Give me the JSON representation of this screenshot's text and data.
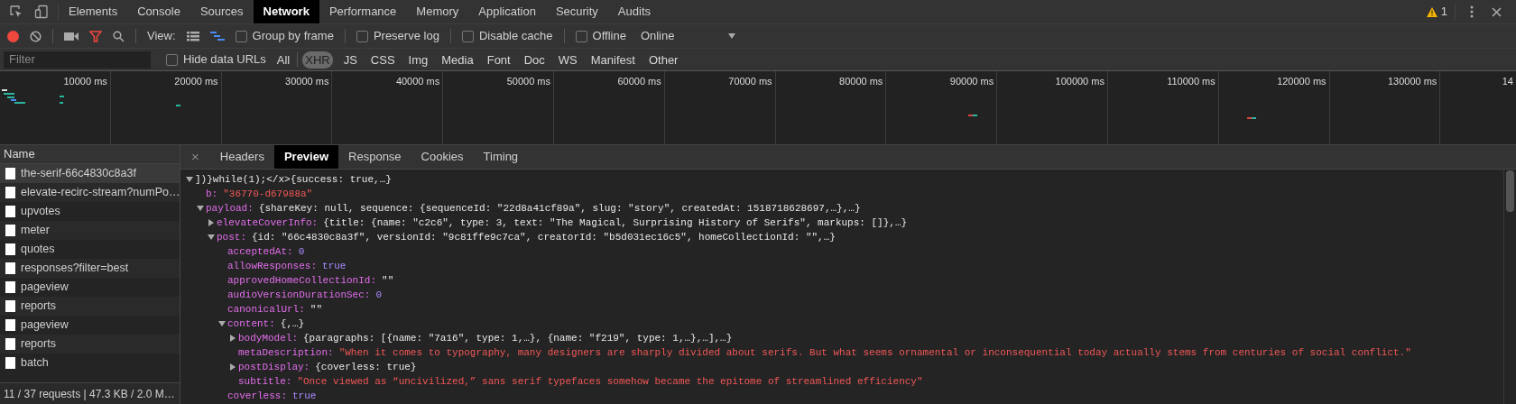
{
  "main_tabs": [
    {
      "label": "Elements",
      "selected": false
    },
    {
      "label": "Console",
      "selected": false
    },
    {
      "label": "Sources",
      "selected": false
    },
    {
      "label": "Network",
      "selected": true
    },
    {
      "label": "Performance",
      "selected": false
    },
    {
      "label": "Memory",
      "selected": false
    },
    {
      "label": "Application",
      "selected": false
    },
    {
      "label": "Security",
      "selected": false
    },
    {
      "label": "Audits",
      "selected": false
    }
  ],
  "warnings": "1",
  "toolbar": {
    "recording": true,
    "filter_active": true,
    "view_label": "View:",
    "large_rows": false,
    "waterfall": true,
    "options": [
      {
        "label": "Group by frame",
        "checked": false
      },
      {
        "label": "Preserve log",
        "checked": false
      },
      {
        "label": "Disable cache",
        "checked": false
      },
      {
        "label": "Offline",
        "checked": false
      }
    ],
    "throttling": "Online"
  },
  "filter_bar": {
    "placeholder": "Filter",
    "hide_data_urls": {
      "label": "Hide data URLs",
      "checked": false
    },
    "types": [
      {
        "label": "All",
        "selected": false
      },
      {
        "label": "XHR",
        "selected": true
      },
      {
        "label": "JS",
        "selected": false
      },
      {
        "label": "CSS",
        "selected": false
      },
      {
        "label": "Img",
        "selected": false
      },
      {
        "label": "Media",
        "selected": false
      },
      {
        "label": "Font",
        "selected": false
      },
      {
        "label": "Doc",
        "selected": false
      },
      {
        "label": "WS",
        "selected": false
      },
      {
        "label": "Manifest",
        "selected": false
      },
      {
        "label": "Other",
        "selected": false
      }
    ]
  },
  "overview": {
    "ticks": [
      "10000 ms",
      "20000 ms",
      "30000 ms",
      "40000 ms",
      "50000 ms",
      "60000 ms",
      "70000 ms",
      "80000 ms",
      "90000 ms",
      "100000 ms",
      "110000 ms",
      "120000 ms",
      "130000 ms",
      "14"
    ]
  },
  "requests": {
    "column": "Name",
    "items": [
      {
        "name": "the-serif-66c4830c8a3f",
        "selected": true
      },
      {
        "name": "elevate-recirc-stream?numPo…",
        "selected": false
      },
      {
        "name": "upvotes",
        "selected": false
      },
      {
        "name": "meter",
        "selected": false
      },
      {
        "name": "quotes",
        "selected": false
      },
      {
        "name": "responses?filter=best",
        "selected": false
      },
      {
        "name": "pageview",
        "selected": false
      },
      {
        "name": "reports",
        "selected": false
      },
      {
        "name": "pageview",
        "selected": false
      },
      {
        "name": "reports",
        "selected": false
      },
      {
        "name": "batch",
        "selected": false
      }
    ],
    "summary": "11 / 37 requests | 47.3 KB / 2.0 M…"
  },
  "detail_tabs": {
    "close": "×",
    "tabs": [
      {
        "label": "Headers",
        "selected": false
      },
      {
        "label": "Preview",
        "selected": true
      },
      {
        "label": "Response",
        "selected": false
      },
      {
        "label": "Cookies",
        "selected": false
      },
      {
        "label": "Timing",
        "selected": false
      }
    ]
  },
  "preview": {
    "label": "])}while(1);</x>",
    "value": "{success: true,…}",
    "kind": "object",
    "expanded": true,
    "children": [
      {
        "key": "b:",
        "value": "\"36770-d67988a\"",
        "kind": "string"
      },
      {
        "key": "payload:",
        "value": "{shareKey: null, sequence: {sequenceId: \"22d8a41cf89a\", slug: \"story\", createdAt: 1518718628697,…},…}",
        "kind": "object",
        "expanded": true,
        "children": [
          {
            "key": "elevateCoverInfo:",
            "value": "{title: {name: \"c2c6\", type: 3, text: \"The Magical, Surprising History of Serifs\", markups: []},…}",
            "kind": "object",
            "expanded": false
          },
          {
            "key": "post:",
            "value": "{id: \"66c4830c8a3f\", versionId: \"9c81ffe9c7ca\", creatorId: \"b5d031ec16c5\", homeCollectionId: \"\",…}",
            "kind": "object",
            "expanded": true,
            "children": [
              {
                "key": "acceptedAt:",
                "value": "0",
                "kind": "number"
              },
              {
                "key": "allowResponses:",
                "value": "true",
                "kind": "boolean"
              },
              {
                "key": "approvedHomeCollectionId:",
                "value": "\"\"",
                "kind": "object"
              },
              {
                "key": "audioVersionDurationSec:",
                "value": "0",
                "kind": "number"
              },
              {
                "key": "canonicalUrl:",
                "value": "\"\"",
                "kind": "object"
              },
              {
                "key": "content:",
                "value": "{,…}",
                "kind": "object",
                "expanded": true,
                "children": [
                  {
                    "key": "bodyModel:",
                    "value": "{paragraphs: [{name: \"7a16\", type: 1,…}, {name: \"f219\", type: 1,…},…],…}",
                    "kind": "object",
                    "expanded": false
                  },
                  {
                    "key": "metaDescription:",
                    "value": "\"When it comes to typography, many designers are sharply divided about serifs. But what seems ornamental or inconsequential today actually stems from centuries of social conflict.\"",
                    "kind": "string"
                  },
                  {
                    "key": "postDisplay:",
                    "value": "{coverless: true}",
                    "kind": "object",
                    "expanded": false
                  },
                  {
                    "key": "subtitle:",
                    "value": "\"Once viewed as “uncivilized,” sans serif typefaces somehow became the epitome of streamlined efficiency\"",
                    "kind": "string"
                  }
                ]
              },
              {
                "key": "coverless:",
                "value": "true",
                "kind": "boolean"
              }
            ]
          }
        ]
      }
    ]
  }
}
